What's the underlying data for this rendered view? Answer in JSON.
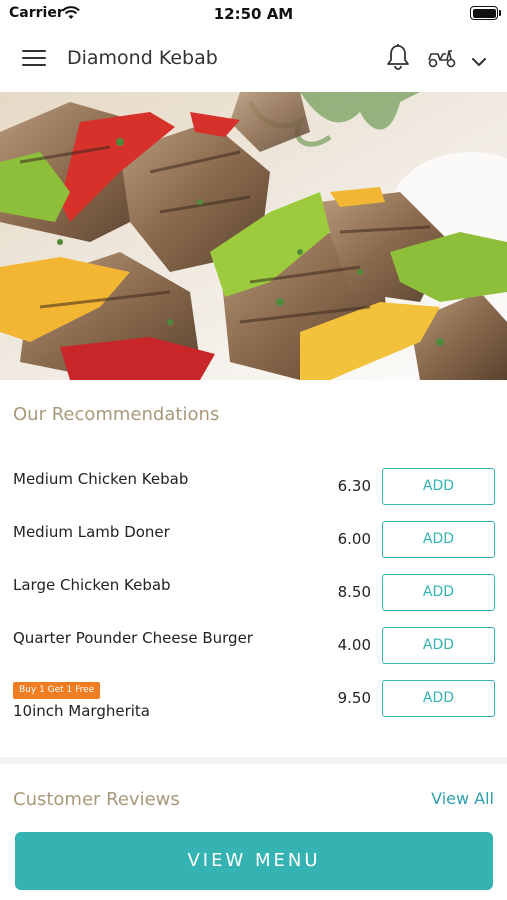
{
  "status_bar": {
    "carrier": "Carrier",
    "time": "12:50 AM"
  },
  "header": {
    "title": "Diamond Kebab",
    "icons": [
      "menu-icon",
      "bell-icon",
      "scooter-icon",
      "chevron-down-icon"
    ]
  },
  "recommendations": {
    "title": "Our Recommendations",
    "add_label": "ADD",
    "items": [
      {
        "name": "Medium Chicken Kebab",
        "price": "6.30"
      },
      {
        "name": "Medium Lamb Doner",
        "price": "6.00"
      },
      {
        "name": "Large Chicken Kebab",
        "price": "8.50"
      },
      {
        "name": "Quarter Pounder Cheese Burger",
        "price": "4.00"
      },
      {
        "name": "10inch Margherita",
        "price": "9.50",
        "badge": "Buy 1 Get 1 Free"
      }
    ]
  },
  "reviews": {
    "title": "Customer Reviews",
    "view_all": "View All"
  },
  "footer": {
    "view_menu": "VIEW MENU"
  },
  "colors": {
    "accent": "#35b3b3",
    "section_title": "#a8997a",
    "badge": "#f07d22",
    "link": "#2f9fb0"
  }
}
